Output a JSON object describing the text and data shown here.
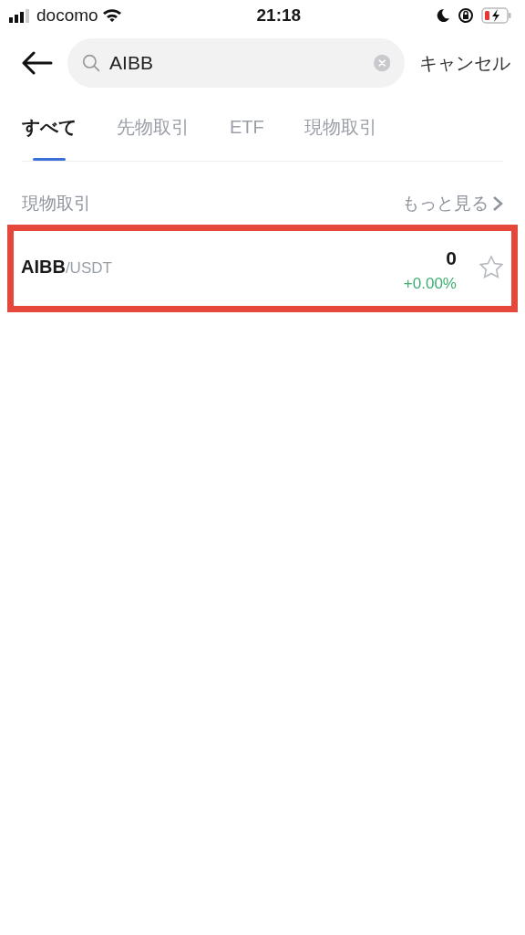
{
  "status_bar": {
    "carrier": "docomo",
    "time": "21:18"
  },
  "search": {
    "value": "AIBB",
    "cancel": "キャンセル"
  },
  "tabs": [
    {
      "label": "すべて",
      "selected": true
    },
    {
      "label": "先物取引",
      "selected": false
    },
    {
      "label": "ETF",
      "selected": false
    },
    {
      "label": "現物取引",
      "selected": false
    }
  ],
  "section": {
    "title": "現物取引",
    "more": "もっと見る"
  },
  "rows": [
    {
      "base": "AIBB",
      "quote": "/USDT",
      "price": "0",
      "change": "+0.00%",
      "favorite": false,
      "highlighted": true
    }
  ]
}
